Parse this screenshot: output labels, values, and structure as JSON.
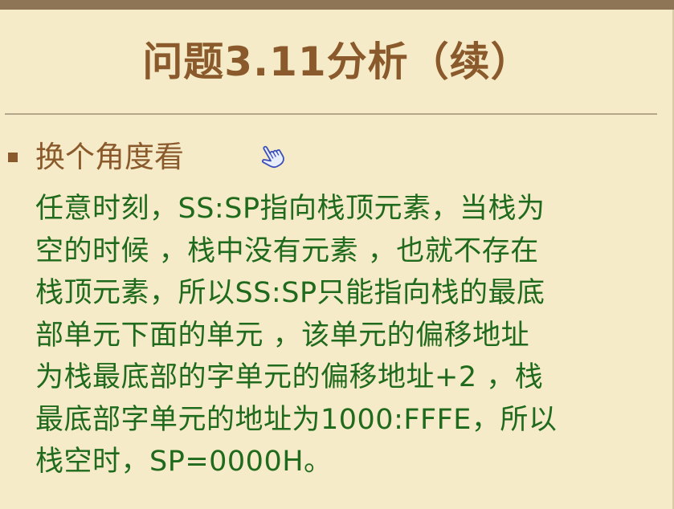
{
  "slide": {
    "title": "问题3.11分析（续）",
    "bullet": "换个角度看",
    "cursor_icon": "hand-pointer-icon",
    "body_lines": [
      "任意时刻，SS:SP指向栈顶元素，当栈为",
      "空的时候 ，栈中没有元素 ，也就不存在",
      "栈顶元素，所以SS:SP只能指向栈的最底",
      "部单元下面的单元 ，该单元的偏移地址",
      "为栈最底部的字单元的偏移地址+2 ，栈",
      "最底部字单元的地址为1000:FFFE，所以",
      "栈空时，SP=0000H。"
    ]
  },
  "colors": {
    "background": "#f6ebc8",
    "top_bar": "#8e7556",
    "title": "#8a5a2c",
    "body_text": "#1f6a1c",
    "rule": "#b4a68a"
  }
}
